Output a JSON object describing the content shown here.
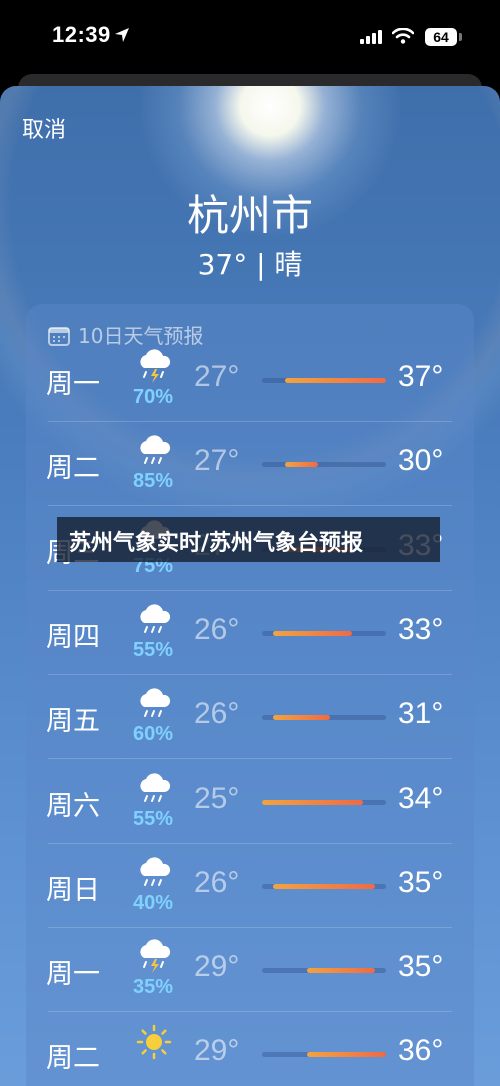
{
  "status_bar": {
    "time": "12:39",
    "battery": "64",
    "icons": [
      "location-arrow-icon",
      "signal-icon",
      "wifi-icon",
      "battery-icon"
    ]
  },
  "header": {
    "cancel_label": "取消",
    "city": "杭州市",
    "current": "37° | 晴"
  },
  "forecast": {
    "title": "10日天气预报",
    "title_icon": "calendar-icon",
    "scale": {
      "min": 25,
      "max": 36
    },
    "days": [
      {
        "day": "周一",
        "icon": "thunderstorm-icon",
        "precip": "70%",
        "low": "27°",
        "high": "37°",
        "low_val": 27,
        "high_val": 37
      },
      {
        "day": "周二",
        "icon": "rain-icon",
        "precip": "85%",
        "low": "27°",
        "high": "30°",
        "low_val": 27,
        "high_val": 30
      },
      {
        "day": "周三",
        "icon": "rain-icon",
        "precip": "75%",
        "low": "27°",
        "high": "33°",
        "low_val": 27,
        "high_val": 33
      },
      {
        "day": "周四",
        "icon": "rain-icon",
        "precip": "55%",
        "low": "26°",
        "high": "33°",
        "low_val": 26,
        "high_val": 33
      },
      {
        "day": "周五",
        "icon": "rain-icon",
        "precip": "60%",
        "low": "26°",
        "high": "31°",
        "low_val": 26,
        "high_val": 31
      },
      {
        "day": "周六",
        "icon": "rain-icon",
        "precip": "55%",
        "low": "25°",
        "high": "34°",
        "low_val": 25,
        "high_val": 34
      },
      {
        "day": "周日",
        "icon": "rain-icon",
        "precip": "40%",
        "low": "26°",
        "high": "35°",
        "low_val": 26,
        "high_val": 35
      },
      {
        "day": "周一",
        "icon": "thunderstorm-icon",
        "precip": "35%",
        "low": "29°",
        "high": "35°",
        "low_val": 29,
        "high_val": 35
      },
      {
        "day": "周二",
        "icon": "sun-icon",
        "precip": "",
        "low": "29°",
        "high": "36°",
        "low_val": 29,
        "high_val": 36
      }
    ]
  },
  "banner": {
    "text": "苏州气象实时/苏州气象台预报"
  },
  "colors": {
    "precip": "#7fd1ff",
    "bar_start": "#f2a340",
    "bar_end": "#f06a45"
  }
}
